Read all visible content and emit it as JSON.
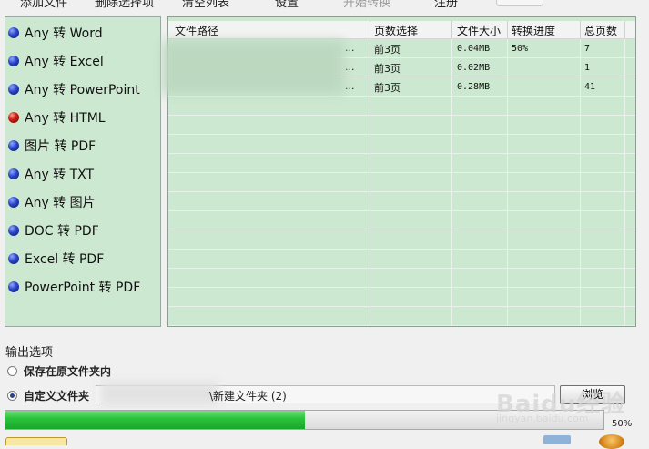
{
  "toolbar": {
    "items": [
      "添加文件",
      "删除选择项",
      "清空列表",
      "设置",
      "开始转换",
      "注册"
    ]
  },
  "conversion_list": [
    {
      "label": "Any 转 Word",
      "dot": "blue"
    },
    {
      "label": "Any 转 Excel",
      "dot": "blue"
    },
    {
      "label": "Any 转 PowerPoint",
      "dot": "blue"
    },
    {
      "label": "Any 转 HTML",
      "dot": "red"
    },
    {
      "label": "图片 转 PDF",
      "dot": "blue"
    },
    {
      "label": "Any 转 TXT",
      "dot": "blue"
    },
    {
      "label": "Any 转 图片",
      "dot": "blue"
    },
    {
      "label": "DOC 转 PDF",
      "dot": "blue"
    },
    {
      "label": "Excel 转 PDF",
      "dot": "blue"
    },
    {
      "label": "PowerPoint 转 PDF",
      "dot": "blue"
    }
  ],
  "file_table": {
    "columns": [
      "文件路径",
      "页数选择",
      "文件大小",
      "转换进度",
      "总页数"
    ],
    "rows": [
      {
        "path": "...",
        "pages": "前3页",
        "size": "0.04MB",
        "progress": "50%",
        "total": "7"
      },
      {
        "path": "...",
        "pages": "前3页",
        "size": "0.02MB",
        "progress": "",
        "total": "1"
      },
      {
        "path": "...",
        "pages": "前3页",
        "size": "0.28MB",
        "progress": "",
        "total": "41"
      }
    ]
  },
  "output": {
    "title": "输出选项",
    "option_original": "保存在原文件夹内",
    "option_custom": "自定义文件夹",
    "selected": "custom",
    "folder_value": "\\新建文件夹 (2)",
    "browse_label": "浏览"
  },
  "progress": {
    "value": 0.5,
    "label": "50%"
  },
  "watermark": {
    "main": "Baidu经验",
    "sub": "jingyan.baidu.com"
  },
  "colors": {
    "panel_green": "#cde8d0",
    "progress_green": "#2cc43d"
  }
}
